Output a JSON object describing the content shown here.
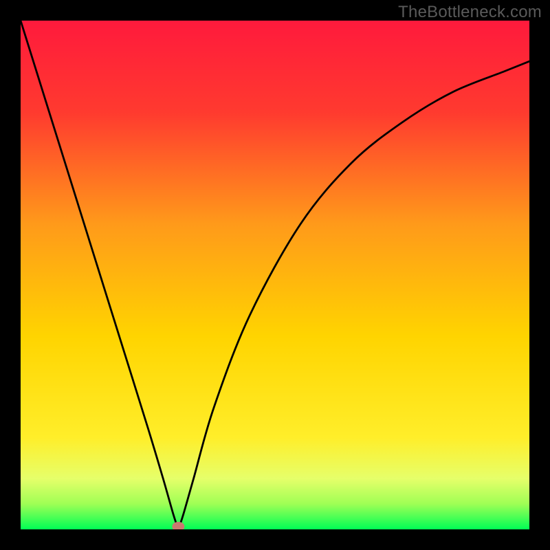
{
  "watermark": "TheBottleneck.com",
  "chart_data": {
    "type": "line",
    "title": "",
    "xlabel": "",
    "ylabel": "",
    "curve": {
      "name": "bottleneck-curve",
      "minimum_x": 0.31,
      "points_x": [
        0.0,
        0.05,
        0.1,
        0.15,
        0.2,
        0.25,
        0.28,
        0.3,
        0.31,
        0.32,
        0.34,
        0.38,
        0.45,
        0.55,
        0.65,
        0.75,
        0.85,
        0.95,
        1.0
      ],
      "points_y": [
        1.0,
        0.84,
        0.68,
        0.52,
        0.36,
        0.2,
        0.1,
        0.03,
        0.0,
        0.03,
        0.1,
        0.24,
        0.42,
        0.6,
        0.72,
        0.8,
        0.86,
        0.9,
        0.92
      ]
    },
    "marker": {
      "x": 0.31,
      "y": 0.0
    },
    "background": {
      "type": "gradient",
      "top_color": "#ff1a3c",
      "mid_color": "#ffd400",
      "bottom_band_color": "#e6ff6a",
      "bottom_color": "#00ff55"
    },
    "xlim": [
      0,
      1
    ],
    "ylim": [
      0,
      1
    ]
  },
  "colors": {
    "frame": "#000000",
    "curve": "#000000",
    "marker_fill": "#c97a6f",
    "watermark": "#5a5a5a"
  }
}
